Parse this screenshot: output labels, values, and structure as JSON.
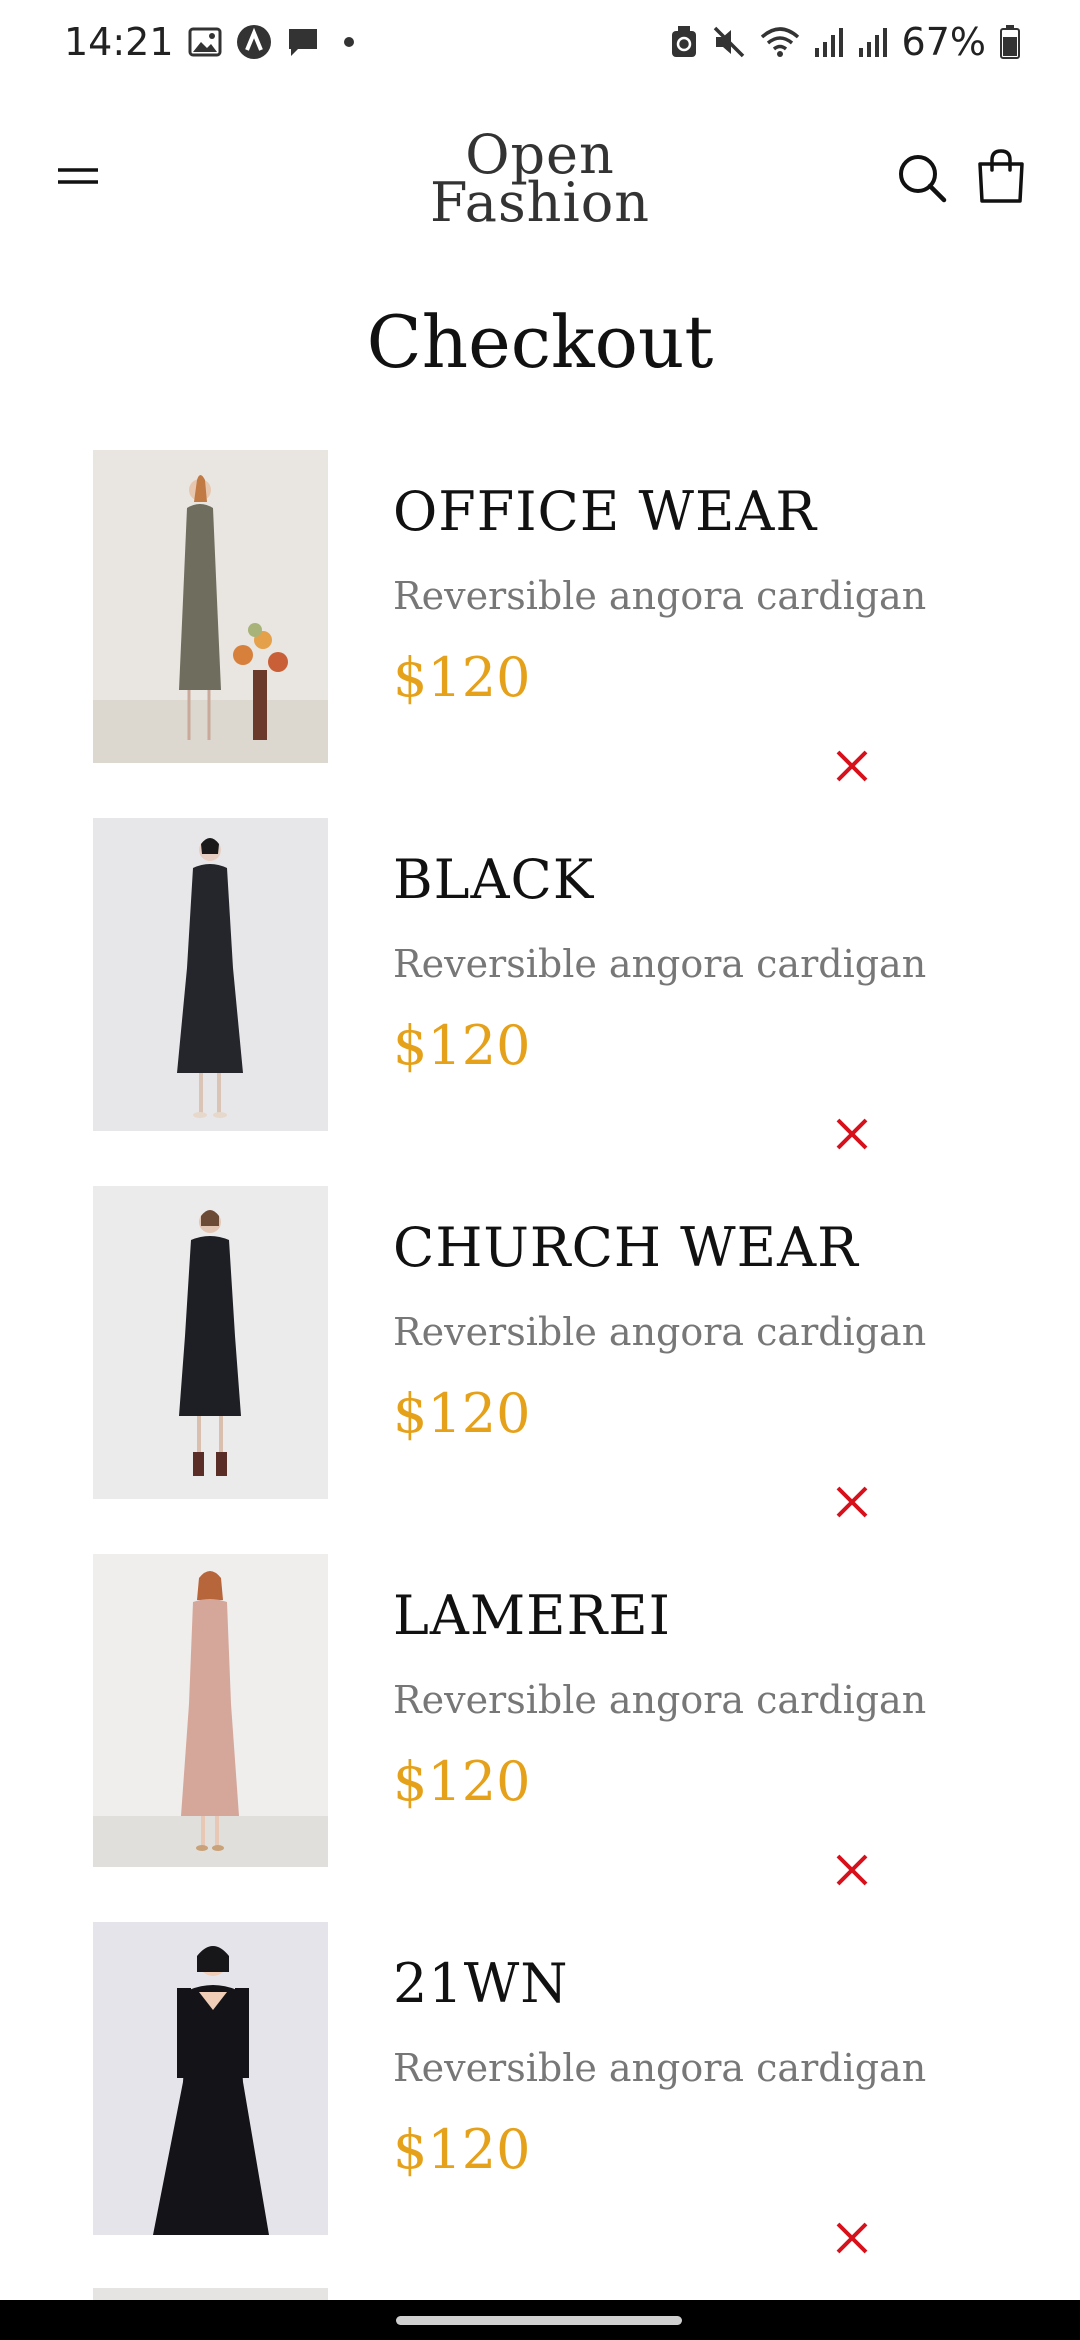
{
  "status_bar": {
    "time": "14:21",
    "battery": "67%",
    "icons": [
      "image-icon",
      "app-icon",
      "message-icon",
      "dot-icon",
      "sync-icon",
      "mute-icon",
      "wifi-icon",
      "signal-icon",
      "signal-icon",
      "battery-icon"
    ]
  },
  "header": {
    "logo_line1": "Open",
    "logo_line2": "Fashion",
    "menu_icon": "menu-icon",
    "search_icon": "search-icon",
    "bag_icon": "shopping-bag-icon"
  },
  "page": {
    "title": "Checkout"
  },
  "items": [
    {
      "title": "OFFICE WEAR",
      "description": "Reversible angora cardigan",
      "price": "$120",
      "image": "product-photo-office-wear",
      "colors": {
        "bg": "#e9e6e1",
        "garment": "#6f6e5e",
        "accent": "#d7803b"
      }
    },
    {
      "title": "BLACK",
      "description": "Reversible angora cardigan",
      "price": "$120",
      "image": "product-photo-black",
      "colors": {
        "bg": "#e7e7e9",
        "garment": "#25262c",
        "accent": "#d9c4b6"
      }
    },
    {
      "title": "CHURCH WEAR",
      "description": "Reversible angora cardigan",
      "price": "$120",
      "image": "product-photo-church-wear",
      "colors": {
        "bg": "#ebebeb",
        "garment": "#1e1f24",
        "accent": "#5a2e26"
      }
    },
    {
      "title": "LAMEREI",
      "description": "Reversible angora cardigan",
      "price": "$120",
      "image": "product-photo-lamerei",
      "colors": {
        "bg": "#efeeec",
        "garment": "#d5a79b",
        "accent": "#c9a27a"
      }
    },
    {
      "title": "21WN",
      "description": "Reversible angora cardigan",
      "price": "$120",
      "image": "product-photo-21wn",
      "colors": {
        "bg": "#e4e4ea",
        "garment": "#141418",
        "accent": "#efcdb6"
      }
    }
  ],
  "colors": {
    "price": "#e5a11a",
    "remove": "#d8101b",
    "description": "#777777"
  }
}
